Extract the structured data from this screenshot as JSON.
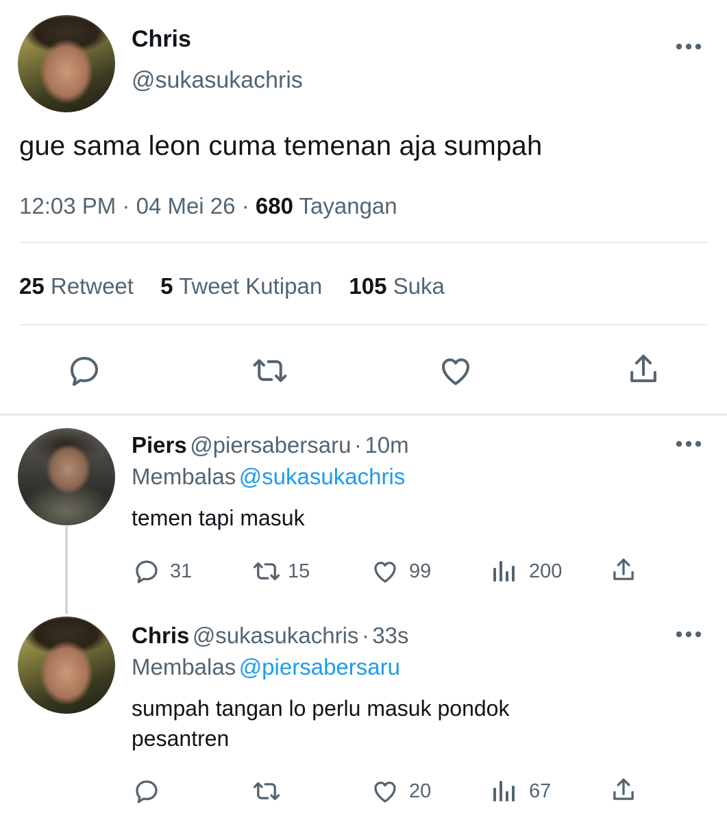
{
  "main_tweet": {
    "author_name": "Chris",
    "author_handle": "@sukasukachris",
    "text": "gue sama leon cuma temenan aja sumpah",
    "time": "12:03 PM",
    "date": "04 Mei 26",
    "views_count": "680",
    "views_label": "Tayangan",
    "retweets_count": "25",
    "retweets_label": "Retweet",
    "quotes_count": "5",
    "quotes_label": "Tweet Kutipan",
    "likes_count": "105",
    "likes_label": "Suka"
  },
  "replies": [
    {
      "author_name": "Piers",
      "author_handle": "@piersabersaru",
      "time_ago": "10m",
      "replying_prefix": "Membalas",
      "replying_to": "@sukasukachris",
      "text": "temen tapi masuk",
      "replies_count": "31",
      "retweets_count": "15",
      "likes_count": "99",
      "views_count": "200"
    },
    {
      "author_name": "Chris",
      "author_handle": "@sukasukachris",
      "time_ago": "33s",
      "replying_prefix": "Membalas",
      "replying_to": "@piersabersaru",
      "text_line1": "sumpah tangan lo perlu masuk pondok",
      "text_line2": "pesantren",
      "replies_count": "",
      "retweets_count": "",
      "likes_count": "20",
      "views_count": "67"
    }
  ],
  "separator": "·",
  "colors": {
    "text_primary": "#0f1419",
    "text_secondary": "#536471",
    "link": "#1d9bf0",
    "divider": "#e6ecf0"
  },
  "icons": [
    "more-icon",
    "reply-icon",
    "retweet-icon",
    "like-icon",
    "share-icon",
    "views-icon"
  ]
}
